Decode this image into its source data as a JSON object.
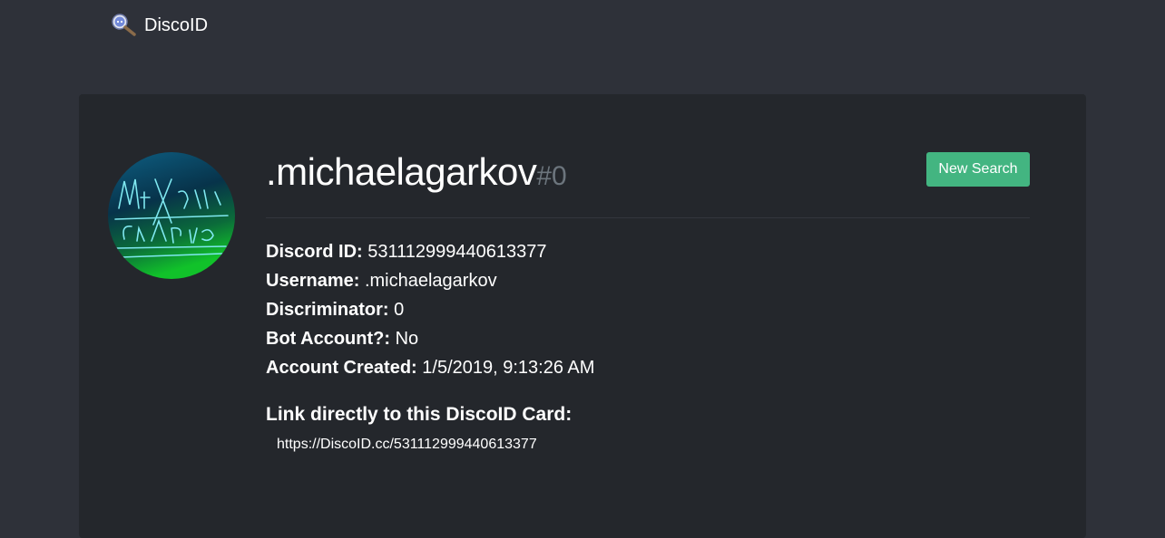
{
  "navbar": {
    "brand_name": "DiscoID",
    "brand_icon": "discord-magnifier-icon"
  },
  "card": {
    "avatar": {
      "description_icon": "user-avatar",
      "scribble_lines": [
        "Михаил",
        "Гарков"
      ]
    },
    "username": ".michaelagarkov",
    "discriminator_display": "#0",
    "new_search_label": "New Search",
    "details": [
      {
        "label": "Discord ID:",
        "value": "531112999440613377"
      },
      {
        "label": "Username:",
        "value": ".michaelagarkov"
      },
      {
        "label": "Discriminator:",
        "value": "0"
      },
      {
        "label": "Bot Account?:",
        "value": "No"
      },
      {
        "label": "Account Created:",
        "value": "1/5/2019, 9:13:26 AM"
      }
    ],
    "link_heading": "Link directly to this DiscoID Card:",
    "link_url": "https://DiscoID.cc/531112999440613377"
  },
  "colors": {
    "page_bg": "#2e3139",
    "card_bg": "#24272c",
    "accent_green": "#43b581",
    "muted": "#6c757d"
  }
}
